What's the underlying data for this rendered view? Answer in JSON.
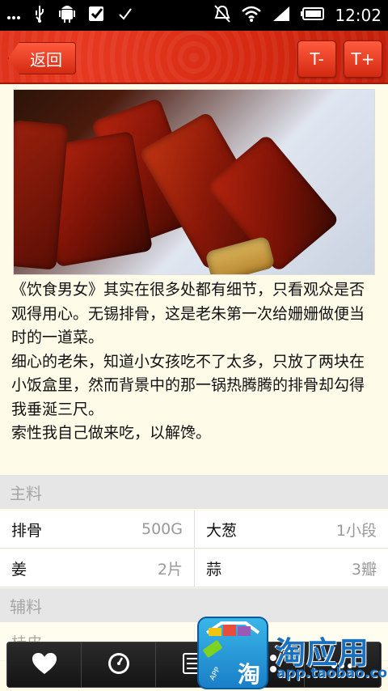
{
  "status": {
    "time": "12:02"
  },
  "header": {
    "back_label": "返回",
    "font_smaller": "T-",
    "font_larger": "T+"
  },
  "intro": {
    "paragraphs": [
      "《饮食男女》其实在很多处都有细节，只看观众是否观得用心。无锡排骨，这是老朱第一次给姗姗做便当时的一道菜。",
      "细心的老朱，知道小女孩吃不了太多，只放了两块在小饭盒里，然而背景中的那一锅热腾腾的排骨却勾得我垂涎三尺。",
      "索性我自己做来吃，以解馋。"
    ]
  },
  "main_section": {
    "title": "主料",
    "rows": [
      [
        {
          "name": "排骨",
          "qty": "500G"
        },
        {
          "name": "大葱",
          "qty": "1小段"
        }
      ],
      [
        {
          "name": "姜",
          "qty": "2片"
        },
        {
          "name": "蒜",
          "qty": "3瓣"
        }
      ]
    ]
  },
  "aux_section": {
    "title": "辅料",
    "rows": [
      [
        {
          "name": "桂皮",
          "qty": ""
        },
        {
          "name": "",
          "qty": ""
        }
      ]
    ]
  },
  "toolbar": {
    "icons": [
      "heart-icon",
      "timer-icon",
      "list-icon",
      "share-icon",
      "more-icon"
    ]
  },
  "watermark": {
    "title": "淘应用",
    "url": "app.taobao.com",
    "bag_text": "淘",
    "tag_text": "APP"
  }
}
